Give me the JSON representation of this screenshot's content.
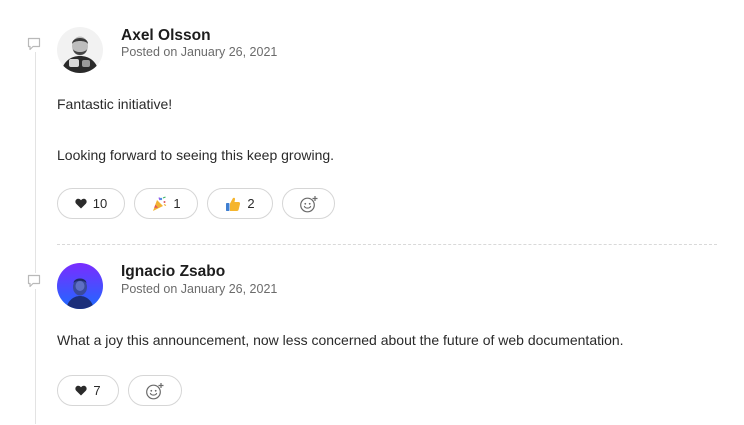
{
  "comments": [
    {
      "author": "Axel Olsson",
      "posted": "Posted on January 26, 2021",
      "avatar_icon": "user-photo-bearded-man",
      "paragraphs": [
        "Fantastic initiative!",
        "Looking forward to seeing this keep growing."
      ],
      "reactions": [
        {
          "icon": "heart-icon",
          "count": "10"
        },
        {
          "icon": "party-popper-icon",
          "count": "1"
        },
        {
          "icon": "thumbs-up-icon",
          "count": "2"
        }
      ],
      "add_reaction_icon": "add-emoji-icon"
    },
    {
      "author": "Ignacio Zsabo",
      "posted": "Posted on January 26, 2021",
      "avatar_icon": "user-photo-blue-purple",
      "paragraphs": [
        "What a joy this announcement, now less concerned about the future of web documentation."
      ],
      "reactions": [
        {
          "icon": "heart-icon",
          "count": "7"
        }
      ],
      "add_reaction_icon": "add-emoji-icon"
    }
  ],
  "colors": {
    "thread_line": "#e3e3e3",
    "pill_border": "#d6d6d6",
    "date_text": "#6b6b6b",
    "heart": "#2b2b2b",
    "thumbs_up": "#f5b52e",
    "avatar2_gradient_top": "#7a2cff",
    "avatar2_gradient_bottom": "#1d6bff"
  }
}
